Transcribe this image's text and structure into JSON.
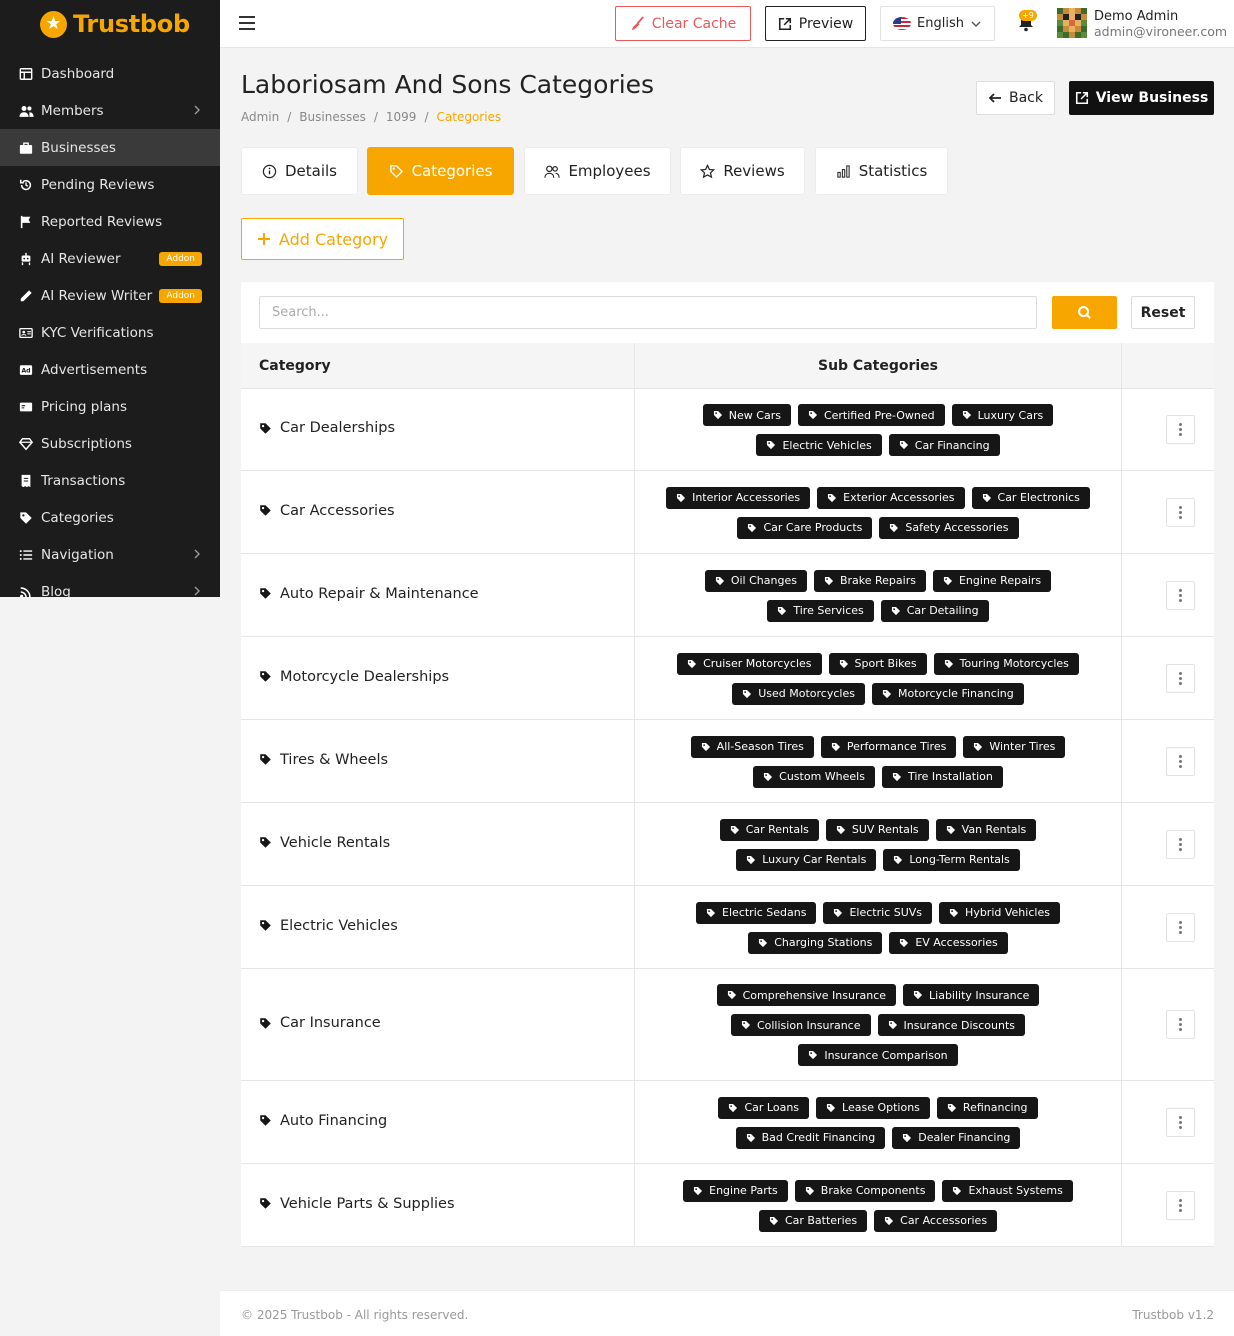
{
  "brand": {
    "name": "Trustbob"
  },
  "sidebar": {
    "items": [
      {
        "label": "Dashboard",
        "icon": "dashboard-icon",
        "chevron": false,
        "active": false
      },
      {
        "label": "Members",
        "icon": "users-icon",
        "chevron": true,
        "active": false
      },
      {
        "label": "Businesses",
        "icon": "briefcase-icon",
        "chevron": false,
        "active": true
      },
      {
        "label": "Pending Reviews",
        "icon": "history-icon",
        "chevron": false,
        "active": false
      },
      {
        "label": "Reported Reviews",
        "icon": "flag-icon",
        "chevron": false,
        "active": false
      },
      {
        "label": "AI Reviewer",
        "icon": "robot-icon",
        "chevron": false,
        "active": false,
        "badge": "Addon"
      },
      {
        "label": "AI Review Writer",
        "icon": "pen-icon",
        "chevron": false,
        "active": false,
        "badge": "Addon"
      },
      {
        "label": "KYC Verifications",
        "icon": "id-card-icon",
        "chevron": false,
        "active": false
      },
      {
        "label": "Advertisements",
        "icon": "ad-icon",
        "chevron": false,
        "active": false
      },
      {
        "label": "Pricing plans",
        "icon": "card-icon",
        "chevron": false,
        "active": false
      },
      {
        "label": "Subscriptions",
        "icon": "gem-icon",
        "chevron": false,
        "active": false
      },
      {
        "label": "Transactions",
        "icon": "receipt-icon",
        "chevron": false,
        "active": false
      },
      {
        "label": "Categories",
        "icon": "tag-icon",
        "chevron": false,
        "active": false
      },
      {
        "label": "Navigation",
        "icon": "list-icon",
        "chevron": true,
        "active": false
      },
      {
        "label": "Blog",
        "icon": "rss-icon",
        "chevron": true,
        "active": false
      }
    ]
  },
  "header": {
    "clear_cache": "Clear Cache",
    "preview": "Preview",
    "language": "English",
    "notification_count": "+9",
    "user_name": "Demo Admin",
    "user_email": "admin@vironeer.com"
  },
  "page": {
    "title": "Laboriosam And Sons Categories",
    "breadcrumb": [
      "Admin",
      "Businesses",
      "1099",
      "Categories"
    ],
    "back": "Back",
    "view_business": "View Business"
  },
  "tabs": [
    {
      "label": "Details",
      "icon": "info-icon",
      "active": false
    },
    {
      "label": "Categories",
      "icon": "tag-icon",
      "active": true
    },
    {
      "label": "Employees",
      "icon": "users-icon",
      "active": false
    },
    {
      "label": "Reviews",
      "icon": "star-icon",
      "active": false
    },
    {
      "label": "Statistics",
      "icon": "bar-chart-icon",
      "active": false
    }
  ],
  "add_category": "Add Category",
  "search": {
    "placeholder": "Search...",
    "reset": "Reset"
  },
  "table": {
    "headers": {
      "category": "Category",
      "sub_categories": "Sub Categories"
    },
    "rows": [
      {
        "category": "Car Dealerships",
        "subs": [
          "New Cars",
          "Certified Pre-Owned",
          "Luxury Cars",
          "Electric Vehicles",
          "Car Financing"
        ]
      },
      {
        "category": "Car Accessories",
        "subs": [
          "Interior Accessories",
          "Exterior Accessories",
          "Car Electronics",
          "Car Care Products",
          "Safety Accessories"
        ]
      },
      {
        "category": "Auto Repair & Maintenance",
        "subs": [
          "Oil Changes",
          "Brake Repairs",
          "Engine Repairs",
          "Tire Services",
          "Car Detailing"
        ]
      },
      {
        "category": "Motorcycle Dealerships",
        "subs": [
          "Cruiser Motorcycles",
          "Sport Bikes",
          "Touring Motorcycles",
          "Used Motorcycles",
          "Motorcycle Financing"
        ]
      },
      {
        "category": "Tires & Wheels",
        "subs": [
          "All-Season Tires",
          "Performance Tires",
          "Winter Tires",
          "Custom Wheels",
          "Tire Installation"
        ]
      },
      {
        "category": "Vehicle Rentals",
        "subs": [
          "Car Rentals",
          "SUV Rentals",
          "Van Rentals",
          "Luxury Car Rentals",
          "Long-Term Rentals"
        ]
      },
      {
        "category": "Electric Vehicles",
        "subs": [
          "Electric Sedans",
          "Electric SUVs",
          "Hybrid Vehicles",
          "Charging Stations",
          "EV Accessories"
        ]
      },
      {
        "category": "Car Insurance",
        "subs": [
          "Comprehensive Insurance",
          "Liability Insurance",
          "Collision Insurance",
          "Insurance Discounts",
          "Insurance Comparison"
        ]
      },
      {
        "category": "Auto Financing",
        "subs": [
          "Car Loans",
          "Lease Options",
          "Refinancing",
          "Bad Credit Financing",
          "Dealer Financing"
        ]
      },
      {
        "category": "Vehicle Parts & Supplies",
        "subs": [
          "Engine Parts",
          "Brake Components",
          "Exhaust Systems",
          "Car Batteries",
          "Car Accessories"
        ]
      }
    ]
  },
  "footer": {
    "copyright": "© 2025 Trustbob - All rights reserved.",
    "version": "Trustbob v1.2"
  },
  "colors": {
    "accent": "#f7a600",
    "sidebar": "#1c1c1c",
    "danger": "#e85a5a"
  }
}
